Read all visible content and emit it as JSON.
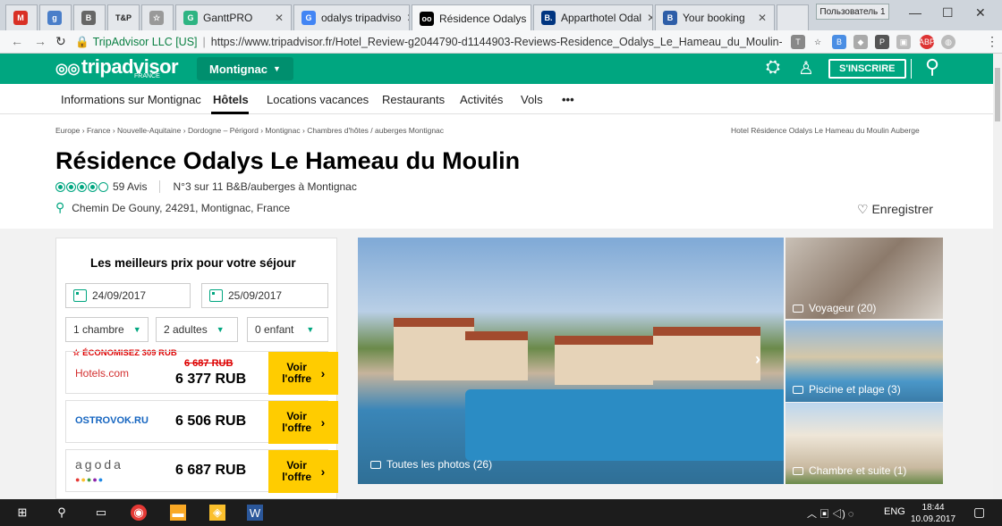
{
  "browser": {
    "tabs": [
      {
        "label": "",
        "fav": "M",
        "color": "#d93025"
      },
      {
        "label": "",
        "fav": "g",
        "color": "#4a7ec9"
      },
      {
        "label": "",
        "fav": "B",
        "color": "#666"
      },
      {
        "label": "T&P",
        "fav": "",
        "color": ""
      },
      {
        "label": "",
        "fav": "☆",
        "color": "#999"
      },
      {
        "label": "GanttPRO",
        "fav": "G",
        "color": "#2db482"
      },
      {
        "label": "odalys tripadviso",
        "fav": "G",
        "color": "#4285f4"
      },
      {
        "label": "Résidence Odalys",
        "fav": "oo",
        "color": "#000"
      },
      {
        "label": "Apparthotel Odal",
        "fav": "B.",
        "color": "#003580"
      },
      {
        "label": "Your booking",
        "fav": "B",
        "color": "#2e5ea8"
      }
    ],
    "profile_label": "Пользователь 1",
    "url_secure": "TripAdvisor LLC [US]",
    "url": "https://www.tripadvisor.fr/Hotel_Review-g2044790-d1144903-Reviews-Residence_Odalys_Le_Hameau_du_Moulin-Mo..."
  },
  "header": {
    "logo": "tripadvisor",
    "logo_sub": "FRANCE",
    "city": "Montignac",
    "signin": "S'INSCRIRE"
  },
  "menu": {
    "items": [
      "Informations sur Montignac",
      "Hôtels",
      "Locations vacances",
      "Restaurants",
      "Activités",
      "Vols",
      "•••"
    ]
  },
  "breadcrumb": {
    "items": [
      "Europe",
      "France",
      "Nouvelle-Aquitaine",
      "Dordogne – Périgord",
      "Montignac",
      "Chambres d'hôtes / auberges Montignac"
    ],
    "right": "Hotel Résidence Odalys Le Hameau du Moulin Auberge"
  },
  "hotel": {
    "name": "Résidence Odalys Le Hameau du Moulin",
    "rating": 4,
    "reviews": "59 Avis",
    "rank": "N°3 sur 11 B&B/auberges à Montignac",
    "address": "Chemin De Gouny, 24291, Montignac, France",
    "save": "Enregistrer"
  },
  "booking": {
    "title": "Les meilleurs prix pour votre séjour",
    "checkin": "24/09/2017",
    "checkout": "25/09/2017",
    "rooms": "1 chambre",
    "adults": "2 adultes",
    "children": "0 enfant",
    "saving": "☆ ÉCONOMISEZ 309 RUB",
    "offers": [
      {
        "brand": "Hotels.com",
        "old_price": "6 687 RUB",
        "price": "6 377 RUB",
        "cta": "Voir l'offre"
      },
      {
        "brand": "OSTROVOK.RU",
        "old_price": "",
        "price": "6 506 RUB",
        "cta": "Voir l'offre"
      },
      {
        "brand": "agoda",
        "old_price": "",
        "price": "6 687 RUB",
        "cta": "Voir l'offre"
      }
    ]
  },
  "photos": {
    "main_caption": "Toutes les photos (26)",
    "thumbs": [
      "Voyageur (20)",
      "Piscine et plage (3)",
      "Chambre et suite (1)"
    ]
  },
  "taskbar": {
    "lang": "ENG",
    "time": "18:44",
    "date": "10.09.2017"
  }
}
